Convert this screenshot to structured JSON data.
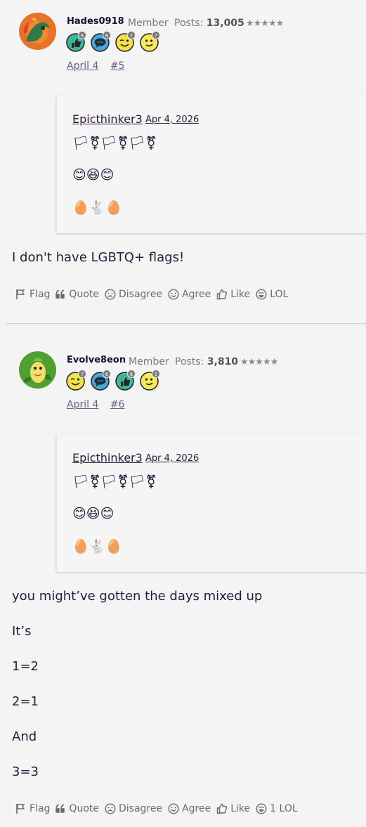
{
  "posts": [
    {
      "username": "Hades0918",
      "role": "Member",
      "posts_label": "Posts:",
      "posts_count": "13,005",
      "stars": "★★★★★",
      "badges": [
        {
          "icon": "thumbs-up-icon",
          "count": "8",
          "color": "#3fb59a"
        },
        {
          "icon": "speech-bubble-icon",
          "count": "8",
          "color": "#4aa6d8"
        },
        {
          "icon": "wink-face-icon",
          "count": "7",
          "color": "#f3e34a"
        },
        {
          "icon": "smile-face-icon",
          "count": "7",
          "color": "#f6ea5a"
        }
      ],
      "date": "April 4",
      "post_number": "#5",
      "quote": {
        "author": "Epicthinker3",
        "date": "Apr 4, 2026",
        "flags_line": "🏳⚧🏳⚧🏳⚧",
        "emoji_line": "😊😆😊",
        "eggs_line": "🥚🐇🥚"
      },
      "body": [
        "I don't have LGBTQ+ flags!"
      ],
      "actions": {
        "flag": "Flag",
        "quote": "Quote",
        "disagree": "Disagree",
        "agree": "Agree",
        "like": "Like",
        "lol": "LOL"
      }
    },
    {
      "username": "Evolve8eon",
      "role": "Member",
      "posts_label": "Posts:",
      "posts_count": "3,810",
      "stars": "★★★★★",
      "badges": [
        {
          "icon": "wink-face-icon",
          "count": "7",
          "color": "#f3e34a"
        },
        {
          "icon": "speech-bubble-icon",
          "count": "6",
          "color": "#4aa6d8"
        },
        {
          "icon": "thumbs-up-icon",
          "count": "6",
          "color": "#3fb59a"
        },
        {
          "icon": "smile-face-icon",
          "count": "5",
          "color": "#f6ea5a"
        }
      ],
      "date": "April 4",
      "post_number": "#6",
      "quote": {
        "author": "Epicthinker3",
        "date": "Apr 4, 2026",
        "flags_line": "🏳⚧🏳⚧🏳⚧",
        "emoji_line": "😊😆😊",
        "eggs_line": "🥚🐇🥚"
      },
      "body": [
        "you might’ve gotten the days mixed up",
        "It’s",
        "1=2",
        "2=1",
        "And",
        "3=3"
      ],
      "actions": {
        "flag": "Flag",
        "quote": "Quote",
        "disagree": "Disagree",
        "agree": "Agree",
        "like": "Like",
        "lol": "1 LOL"
      }
    }
  ]
}
